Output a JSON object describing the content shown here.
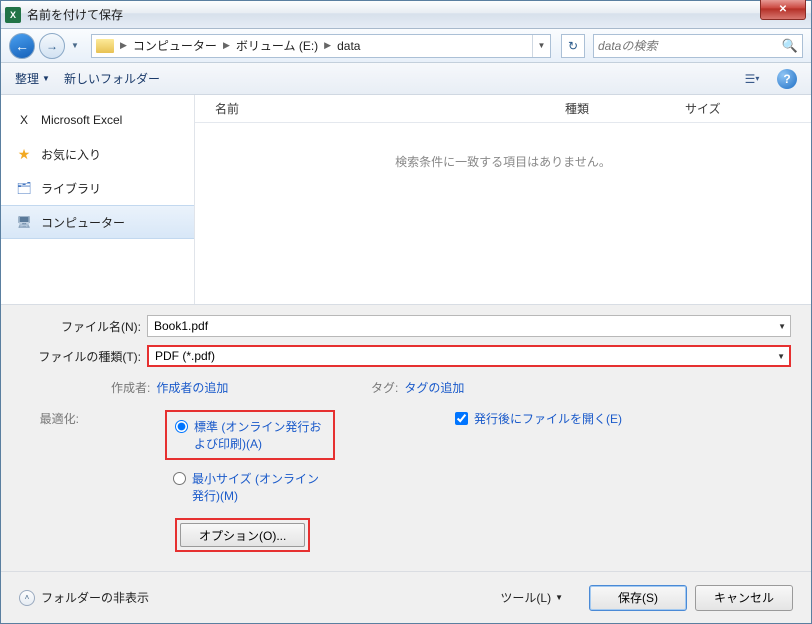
{
  "title": "名前を付けて保存",
  "breadcrumbs": {
    "root": "コンピューター",
    "vol": "ボリューム (E:)",
    "folder": "data"
  },
  "search": {
    "placeholder": "dataの検索"
  },
  "toolbar": {
    "organize": "整理",
    "newfolder": "新しいフォルダー"
  },
  "sidebar": {
    "items": [
      {
        "label": "Microsoft Excel"
      },
      {
        "label": "お気に入り"
      },
      {
        "label": "ライブラリ"
      },
      {
        "label": "コンピューター"
      }
    ]
  },
  "columns": {
    "name": "名前",
    "type": "種類",
    "size": "サイズ"
  },
  "empty": "検索条件に一致する項目はありません。",
  "filename_label": "ファイル名(N):",
  "filename_value": "Book1.pdf",
  "filetype_label": "ファイルの種類(T):",
  "filetype_value": "PDF (*.pdf)",
  "meta": {
    "author_lbl": "作成者:",
    "author_lnk": "作成者の追加",
    "tag_lbl": "タグ:",
    "tag_lnk": "タグの追加"
  },
  "optimize": {
    "label": "最適化:",
    "standard": "標準 (オンライン発行および印刷)(A)",
    "min": "最小サイズ (オンライン発行)(M)",
    "openafter": "発行後にファイルを開く(E)",
    "options_btn": "オプション(O)..."
  },
  "footer": {
    "hide": "フォルダーの非表示",
    "tools": "ツール(L)",
    "save": "保存(S)",
    "cancel": "キャンセル"
  }
}
